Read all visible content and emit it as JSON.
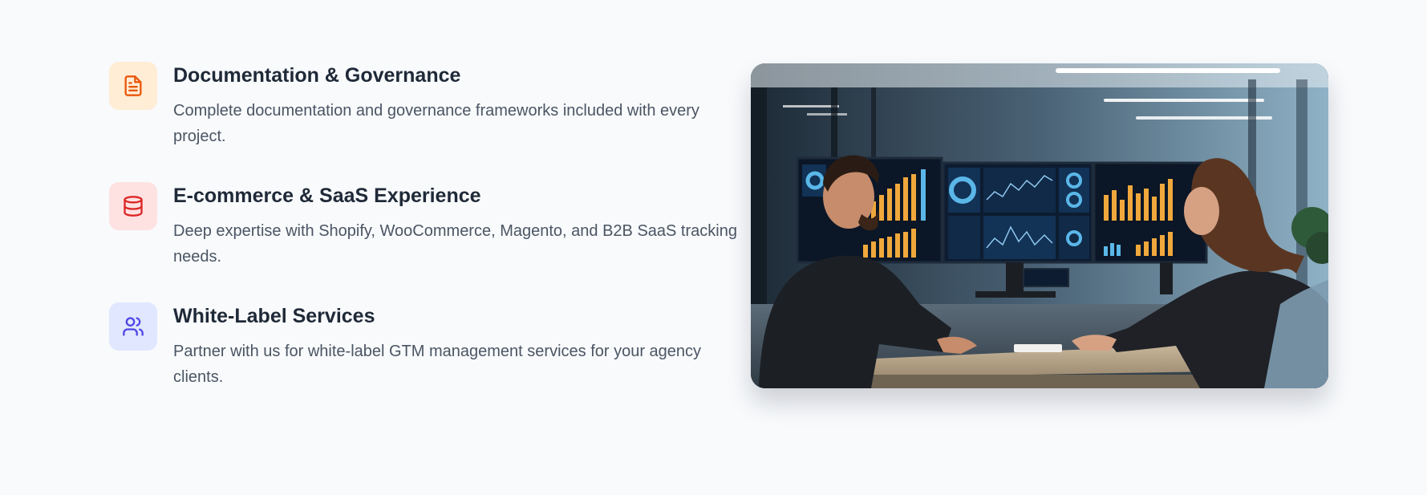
{
  "features": [
    {
      "icon": "document-icon",
      "title": "Documentation & Governance",
      "description": "Complete documentation and governance frameworks included with every project."
    },
    {
      "icon": "database-icon",
      "title": "E-commerce & SaaS Experience",
      "description": "Deep expertise with Shopify, WooCommerce, Magento, and B2B SaaS tracking needs."
    },
    {
      "icon": "users-icon",
      "title": "White-Label Services",
      "description": "Partner with us for white-label GTM management services for your agency clients."
    }
  ],
  "colors": {
    "background": "#f8fafc",
    "orange": "#ea580c",
    "red": "#dc2626",
    "indigo": "#4f46e5"
  }
}
